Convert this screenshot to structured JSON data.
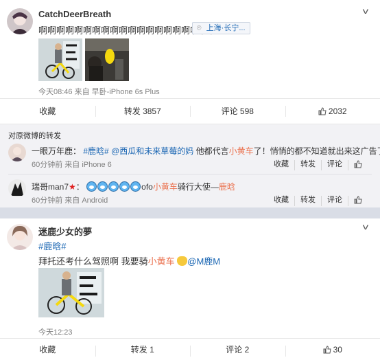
{
  "post1": {
    "username": "CatchDeerBreath",
    "text": "啊啊啊啊啊啊啊啊啊啊啊啊啊啊啊啊啊啊啊啊",
    "location": "上海·长宁...",
    "meta": "今天08:46 来自 早卧-iPhone 6s Plus",
    "actions": {
      "collect": "收藏",
      "repost": "转发 3857",
      "comment": "评论 598",
      "like": "2032"
    }
  },
  "repost_section": {
    "header": "对原微博的转发",
    "items": [
      {
        "name": "一眼万年鹿",
        "separator": "：",
        "tag": "#鹿晗#",
        "mention": "@西瓜和未来草莓的妈",
        "text_a": "他都代言",
        "highlight": "小黄车",
        "text_b": "了！悄悄的都不知道就出来这广告了",
        "meta": "60分钟前 来自 iPhone 6",
        "actions": [
          "收藏",
          "转发",
          "评论"
        ]
      },
      {
        "name": "瑞哥man7",
        "separator": "：",
        "prefix": "ofo",
        "highlight": "小黄车",
        "text_a": "骑行大使—",
        "tail": "鹿晗",
        "meta": "60分钟前 来自 Android",
        "actions": [
          "收藏",
          "转发",
          "评论"
        ]
      }
    ]
  },
  "post2": {
    "username": "迷鹿少女的夢",
    "tag": "#鹿晗#",
    "text_a": "拜托还考什么驾照啊 我要骑",
    "highlight": "小黄车",
    "mention": "@M鹿M",
    "meta": "今天12:23",
    "actions": {
      "collect": "收藏",
      "repost": "转发 1",
      "comment": "评论 2",
      "like": "30"
    }
  },
  "colors": {
    "accent": "#eb7350",
    "link": "#1a66b3",
    "yellow": "#f5d90f"
  }
}
